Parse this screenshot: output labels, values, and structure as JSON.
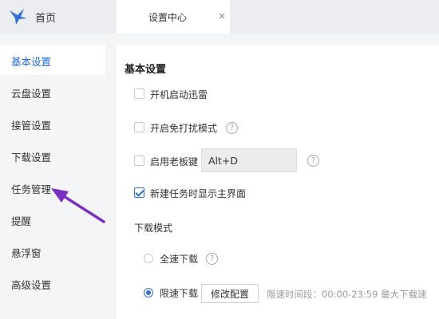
{
  "header": {
    "home_label": "首页",
    "tab_title": "设置中心",
    "tab_close": "×"
  },
  "sidebar": {
    "items": [
      {
        "label": "基本设置",
        "active": true
      },
      {
        "label": "云盘设置"
      },
      {
        "label": "接管设置"
      },
      {
        "label": "下载设置"
      },
      {
        "label": "任务管理"
      },
      {
        "label": "提醒"
      },
      {
        "label": "悬浮窗"
      },
      {
        "label": "高级设置"
      }
    ]
  },
  "main": {
    "section_title": "基本设置",
    "options": {
      "startup": {
        "label": "开机启动迅雷",
        "checked": false
      },
      "no_disturb": {
        "label": "开启免打扰模式",
        "checked": false
      },
      "boss_key": {
        "label": "启用老板键",
        "checked": false,
        "value": "Alt+D"
      },
      "show_main": {
        "label": "新建任务时显示主界面",
        "checked": true
      }
    },
    "download_mode": {
      "title": "下载模式",
      "full_speed": {
        "label": "全速下载",
        "selected": false
      },
      "limited": {
        "label": "限速下载",
        "selected": true
      },
      "modify_button": "修改配置",
      "limit_info": "限速时间段：00:00-23:59   最大下载速"
    }
  },
  "colors": {
    "accent": "#1f69e6",
    "annotation_arrow": "#7b2fbf"
  },
  "icons": [
    "app-logo-icon",
    "close-icon",
    "help-icon",
    "checkmark-icon",
    "arrow-annotation"
  ]
}
